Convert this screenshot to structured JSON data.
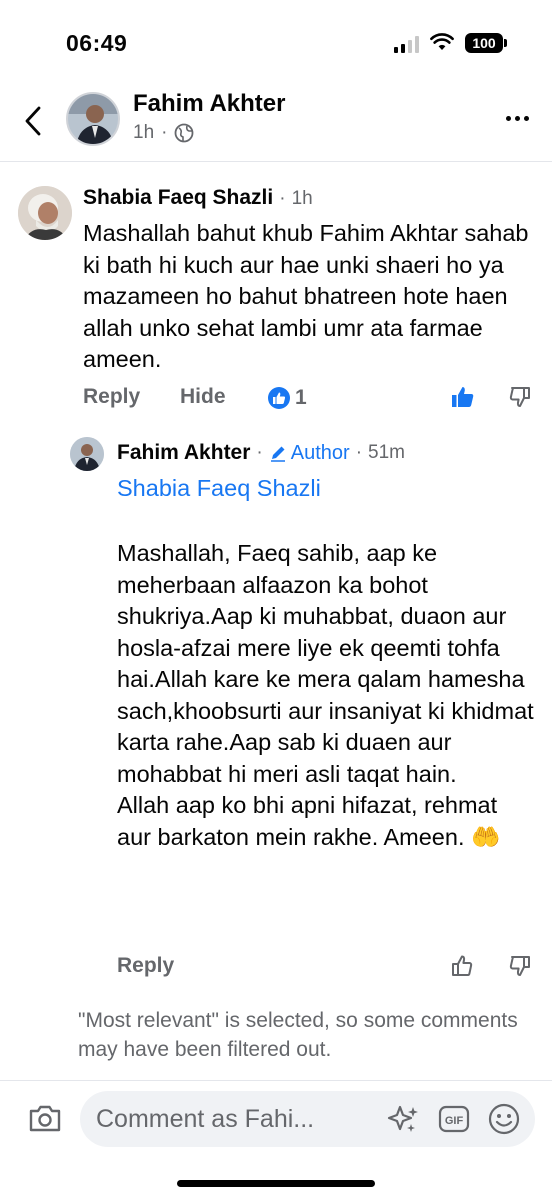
{
  "status_bar": {
    "time": "06:49",
    "battery": "100"
  },
  "header": {
    "author_name": "Fahim Akhter",
    "post_time": "1h",
    "separator": "·",
    "icons": [
      "chevron-left-icon",
      "globe-icon",
      "more-options-icon"
    ]
  },
  "comment": {
    "author": "Shabia Faeq Shazli",
    "time_separator": "·",
    "time": "1h",
    "text": "Mashallah bahut khub Fahim Akhtar sahab ki bath hi kuch aur hae unki shaeri ho ya mazameen ho bahut bhatreen hote haen allah unko sehat lambi umr ata farmae ameen.",
    "actions": {
      "reply": "Reply",
      "hide": "Hide",
      "reaction_count": "1"
    }
  },
  "reply": {
    "author": "Fahim Akhter",
    "separator": "·",
    "author_badge": "Author",
    "time_separator": "·",
    "time": "51m",
    "mention": "Shabia Faeq Shazli",
    "text": "Mashallah, Faeq sahib, aap ke meherbaan alfaazon ka bohot shukriya.Aap ki muhabbat, duaon aur hosla-afzai mere liye ek qeemti tohfa hai.Allah kare ke mera qalam hamesha sach,khoobsurti aur insaniyat ki khidmat karta rahe.Aap sab ki duaen aur mohabbat hi meri asli taqat hain.\nAllah aap ko bhi apni hifazat, rehmat aur barkaton mein rakhe. Ameen. 🤲",
    "actions": {
      "reply": "Reply"
    }
  },
  "filter_note": "\"Most relevant\" is selected, so some comments may have been filtered out.",
  "composer": {
    "placeholder": "Comment as Fahi...",
    "icons": [
      "camera-icon",
      "sparkle-sticker-icon",
      "gif-icon",
      "emoji-icon"
    ]
  },
  "colors": {
    "accent": "#1877f2",
    "text": "#050505",
    "secondary_text": "#65676b",
    "input_bg": "#f0f2f5",
    "divider": "#e4e6eb"
  }
}
